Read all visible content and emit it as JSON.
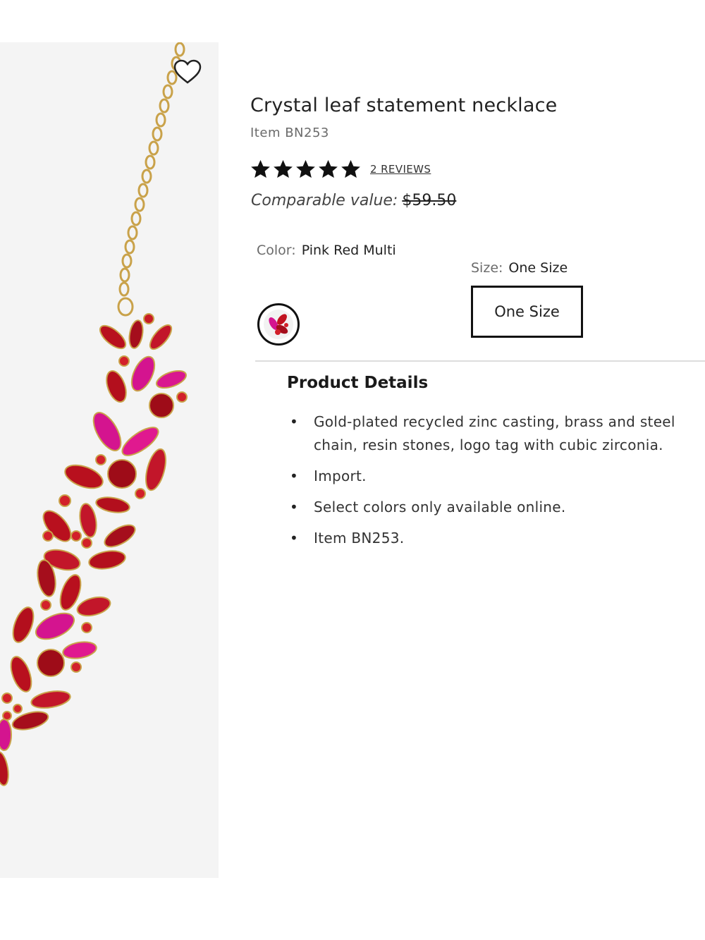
{
  "product": {
    "title": "Crystal leaf statement necklace",
    "item_number": "Item BN253",
    "rating": 5,
    "rating_max": 5,
    "reviews_label": "2 REVIEWS",
    "comparable_label": "Comparable value:",
    "comparable_price": "$59.50"
  },
  "color": {
    "label": "Color:",
    "value": "Pink Red Multi",
    "swatch_icon": "necklace-swatch-icon"
  },
  "size": {
    "label": "Size:",
    "value": "One Size",
    "button_label": "One Size"
  },
  "details": {
    "heading": "Product Details",
    "items": [
      "Gold-plated recycled zinc casting, brass and steel chain, resin stones, logo tag with cubic zirconia.",
      "Import.",
      "Select colors only available online.",
      "Item BN253."
    ]
  },
  "icons": {
    "wishlist": "heart-icon",
    "star": "star-icon"
  },
  "colors": {
    "star": "#111111",
    "crystal_red": "#c1121f",
    "crystal_pink": "#d4148f",
    "gold": "#c9a24a"
  }
}
